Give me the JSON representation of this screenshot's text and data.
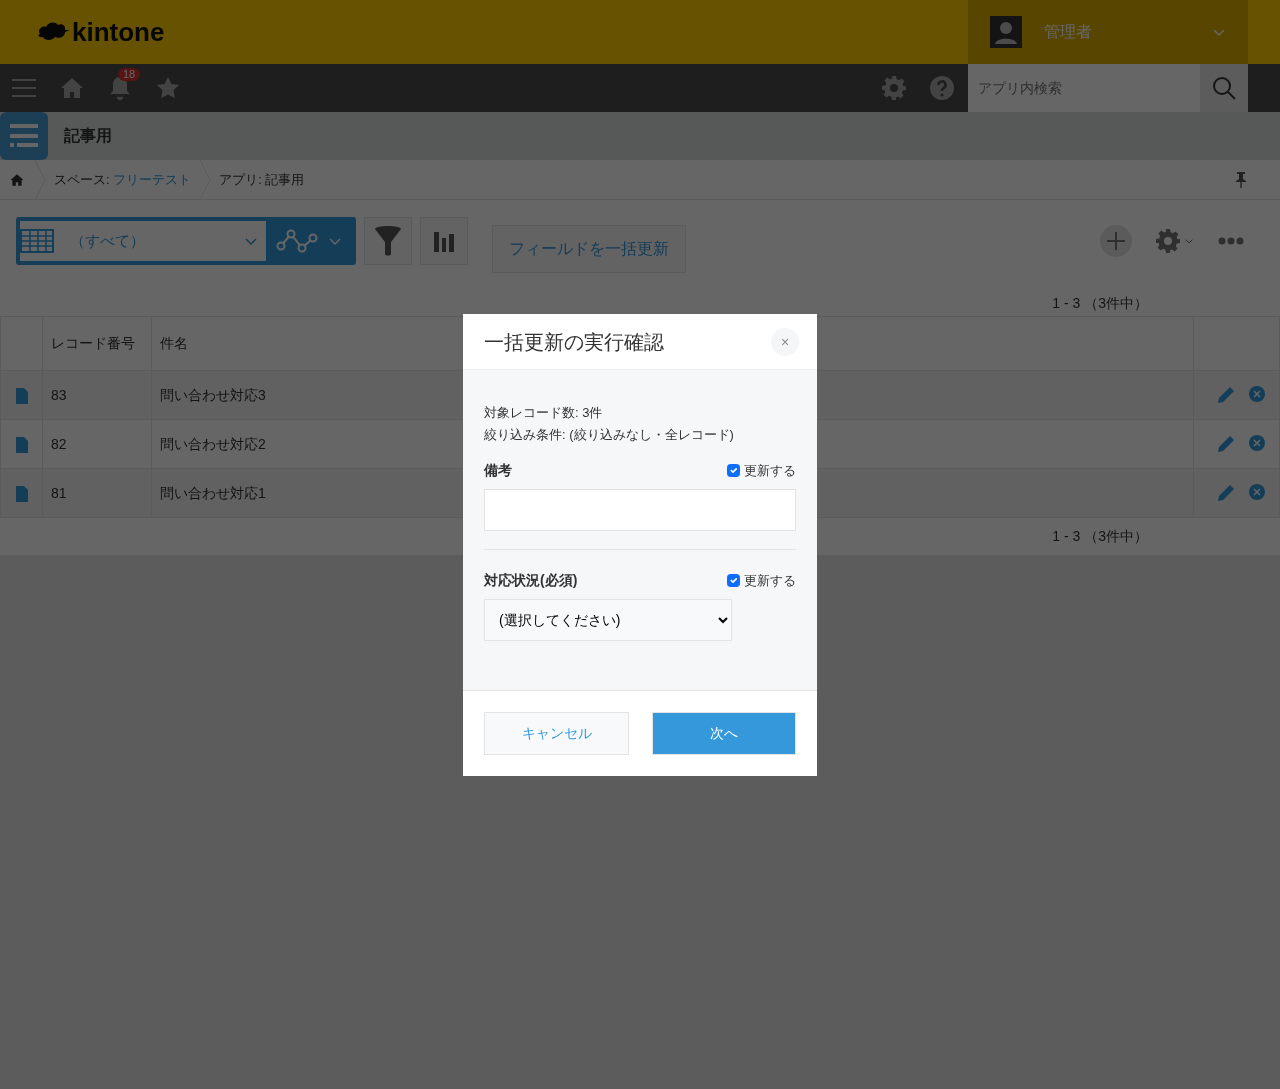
{
  "header": {
    "logo": "kintone",
    "user": "管理者"
  },
  "nav": {
    "notification_count": "18",
    "search_placeholder": "アプリ内検索"
  },
  "app": {
    "title": "記事用"
  },
  "breadcrumb": [
    {
      "kind": "link",
      "prefix": "スペース:",
      "link": "フリーテスト"
    },
    {
      "kind": "text",
      "text": "アプリ: 記事用"
    }
  ],
  "toolbar": {
    "view": "（すべて）",
    "bulk_update_button": "フィールドを一括更新"
  },
  "pagination_top": "1 - 3 （3件中）",
  "table": {
    "columns": [
      "レコード番号",
      "件名"
    ],
    "rows": [
      {
        "number": "83",
        "title": "問い合わせ対応3"
      },
      {
        "number": "82",
        "title": "問い合わせ対応2"
      },
      {
        "number": "81",
        "title": "問い合わせ対応1"
      }
    ]
  },
  "pagination_bottom": "1 - 3 （3件中）",
  "dialog": {
    "title": "一括更新の実行確認",
    "close": "×",
    "info_lines": [
      "対象レコード数: 3件",
      "絞り込み条件: (絞り込みなし・全レコード)"
    ],
    "fields": [
      {
        "kind": "text",
        "label": "備考",
        "update_label": "更新する",
        "checked": true
      },
      {
        "kind": "select",
        "label": "対応状況(必須)",
        "update_label": "更新する",
        "checked": true,
        "value": "(選択してください)"
      }
    ],
    "cancel_button": "キャンセル",
    "next_button": "次へ"
  }
}
